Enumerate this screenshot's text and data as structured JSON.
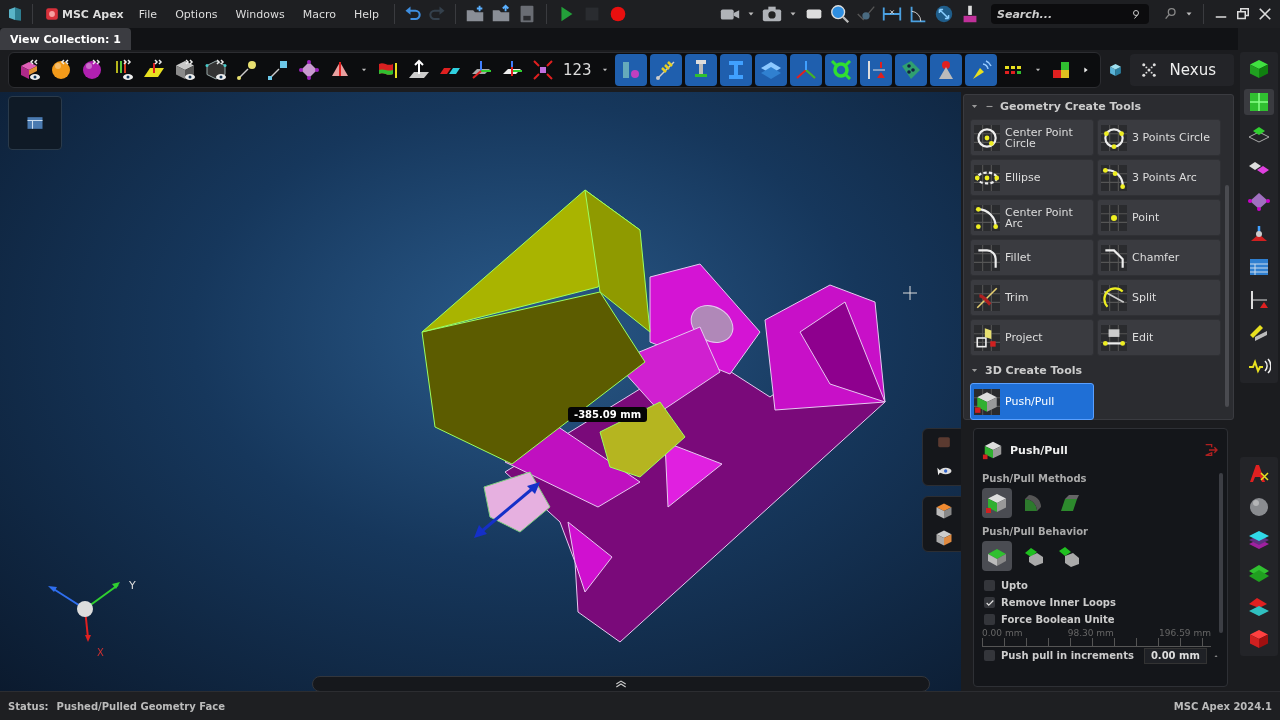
{
  "menu_bar": {
    "app_name": "MSC Apex",
    "menus": [
      "File",
      "Options",
      "Windows",
      "Macro",
      "Help"
    ],
    "search": {
      "placeholder": "Search..."
    }
  },
  "tabs": [
    {
      "label": "View Collection: 1",
      "selected": true
    }
  ],
  "toolbar": {
    "number_label": "123",
    "nexus_label": "Nexus"
  },
  "viewport": {
    "dimension_label": "-385.09 mm",
    "axes": [
      "Y",
      "X"
    ]
  },
  "geometry_tools": {
    "title": "Geometry Create Tools",
    "tools": [
      {
        "label": "Center Point Circle",
        "selected": false
      },
      {
        "label": "3 Points Circle",
        "selected": false
      },
      {
        "label": "Ellipse",
        "selected": false
      },
      {
        "label": "3 Points Arc",
        "selected": false
      },
      {
        "label": "Center Point Arc",
        "selected": false
      },
      {
        "label": "Point",
        "selected": false
      },
      {
        "label": "Fillet",
        "selected": false
      },
      {
        "label": "Chamfer",
        "selected": false
      },
      {
        "label": "Trim",
        "selected": false
      },
      {
        "label": "Split",
        "selected": false
      },
      {
        "label": "Project",
        "selected": false
      },
      {
        "label": "Edit",
        "selected": false
      }
    ],
    "section": {
      "title": "3D Create Tools",
      "tools": [
        {
          "label": "Push/Pull",
          "selected": true
        }
      ]
    }
  },
  "push_pull": {
    "title": "Push/Pull",
    "methods_label": "Push/Pull Methods",
    "methods": [
      {
        "selected": true
      },
      {
        "selected": false
      },
      {
        "selected": false
      }
    ],
    "behavior_label": "Push/Pull Behavior",
    "behaviors": [
      {
        "selected": true
      },
      {
        "selected": false
      },
      {
        "selected": false
      }
    ],
    "options": [
      {
        "label": "Upto",
        "checked": false
      },
      {
        "label": "Remove Inner Loops",
        "checked": true
      },
      {
        "label": "Force Boolean Unite",
        "checked": false
      }
    ],
    "scale": [
      "0.00 mm",
      "98.30 mm",
      "196.59 mm"
    ],
    "increment": {
      "label": "Push pull in increments",
      "checked": false,
      "value": "0.00 mm"
    }
  },
  "status_bar": {
    "label": "Status:",
    "message": "Pushed/Pulled Geometry Face",
    "version": "MSC Apex 2024.1"
  }
}
